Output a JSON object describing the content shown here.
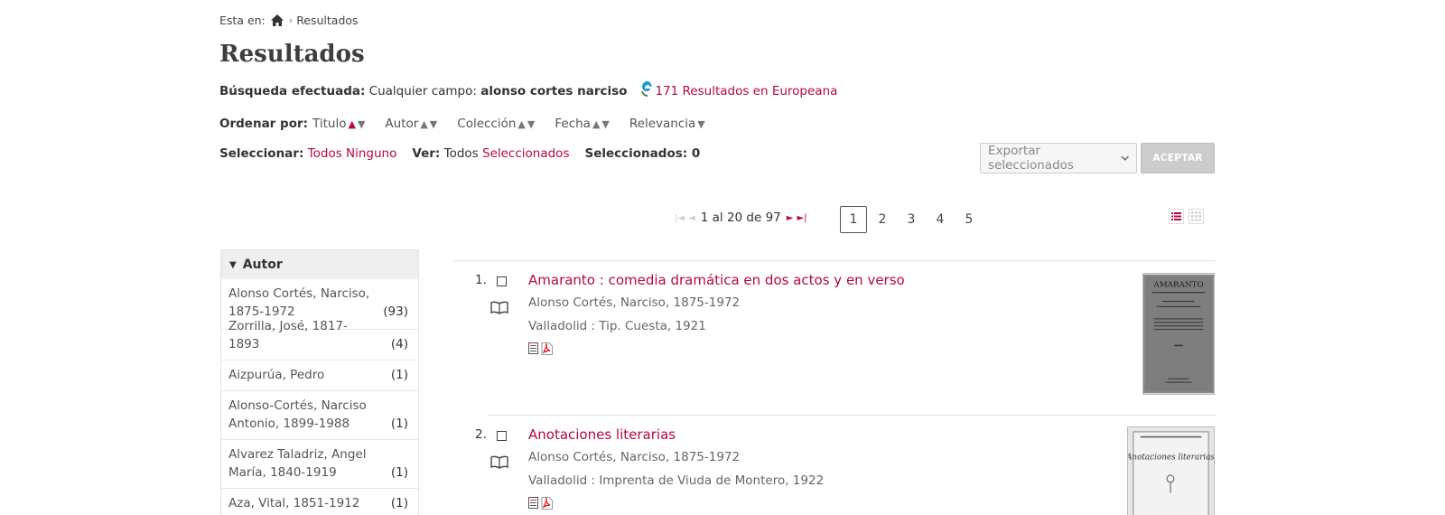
{
  "breadcrumb": {
    "prefix": "Esta en:",
    "separator": "›",
    "current": "Resultados"
  },
  "page_title": "Resultados",
  "search": {
    "label": "Búsqueda efectuada:",
    "field": "Cualquier campo:",
    "query": "alonso cortes narciso",
    "europeana_link": "171 Resultados en Europeana"
  },
  "sort": {
    "label": "Ordenar por:",
    "options": [
      {
        "label": "Titulo",
        "up": "▲",
        "down": "▼"
      },
      {
        "label": "Autor",
        "up": "▲",
        "down": "▼"
      },
      {
        "label": "Colección",
        "up": "▲",
        "down": "▼"
      },
      {
        "label": "Fecha",
        "up": "▲",
        "down": "▼"
      },
      {
        "label": "Relevancia",
        "down": "▼"
      }
    ]
  },
  "selection": {
    "label": "Seleccionar:",
    "all": "Todos",
    "none": "Ninguno",
    "view_label": "Ver:",
    "view_all": "Todos",
    "view_selected": "Seleccionados",
    "count_label": "Seleccionados: 0"
  },
  "export": {
    "placeholder": "Exportar seleccionados",
    "accept": "ACEPTAR"
  },
  "pagination": {
    "range": "1 al 20 de 97",
    "first": "|◄",
    "prev": "◄",
    "next": "►",
    "last": "►|",
    "pages": [
      "1",
      "2",
      "3",
      "4",
      "5"
    ]
  },
  "facet": {
    "title": "Autor",
    "items": [
      {
        "name": "Alonso Cortés, Narciso, 1875-1972",
        "count": "(93)"
      },
      {
        "name": "Zorrilla, José, 1817-1893",
        "count": "(4)"
      },
      {
        "name": "Aizpurúa, Pedro",
        "count": "(1)"
      },
      {
        "name": "Alonso-Cortés, Narciso Antonio, 1899-1988",
        "count": "(1)"
      },
      {
        "name": "Alvarez Taladriz, Angel María, 1840-1919",
        "count": "(1)"
      },
      {
        "name": "Aza, Vital, 1851-1912",
        "count": "(1)"
      }
    ]
  },
  "results": [
    {
      "num": "1.",
      "title": "Amaranto : comedia dramática en dos actos y en verso",
      "author": "Alonso Cortés, Narciso, 1875-1972",
      "publisher": "Valladolid : Tip. Cuesta, 1921",
      "thumb_text": "AMARANTO"
    },
    {
      "num": "2.",
      "title": "Anotaciones literarias",
      "author": "Alonso Cortés, Narciso, 1875-1972",
      "publisher": "Valladolid : Imprenta de Viuda de Montero, 1922",
      "thumb_text": "Anotaciones literarias"
    }
  ]
}
